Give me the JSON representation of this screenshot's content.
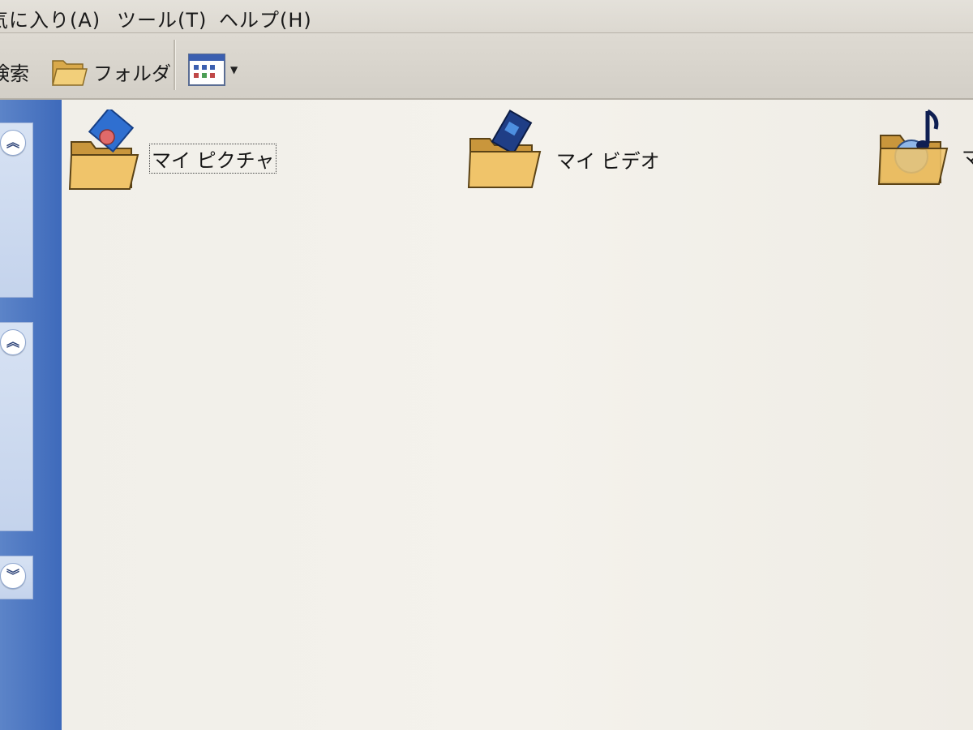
{
  "menubar": {
    "items": [
      {
        "label": "気に入り(A)"
      },
      {
        "label": "ツール(T)"
      },
      {
        "label": "ヘルプ(H)"
      }
    ]
  },
  "toolbar": {
    "search_label": "検索",
    "folders_label": "フォルダ",
    "views_icon": "views-icon"
  },
  "items": [
    {
      "label": "マイ ピクチャ",
      "icon": "my-pictures-folder-icon",
      "selected": true
    },
    {
      "label": "マイ ビデオ",
      "icon": "my-videos-folder-icon",
      "selected": false
    },
    {
      "label": "マ",
      "icon": "my-music-folder-icon",
      "selected": false
    }
  ],
  "colors": {
    "taskpane": "#3e6abb",
    "content": "#f2f0ea",
    "menubar": "#dedad3"
  }
}
